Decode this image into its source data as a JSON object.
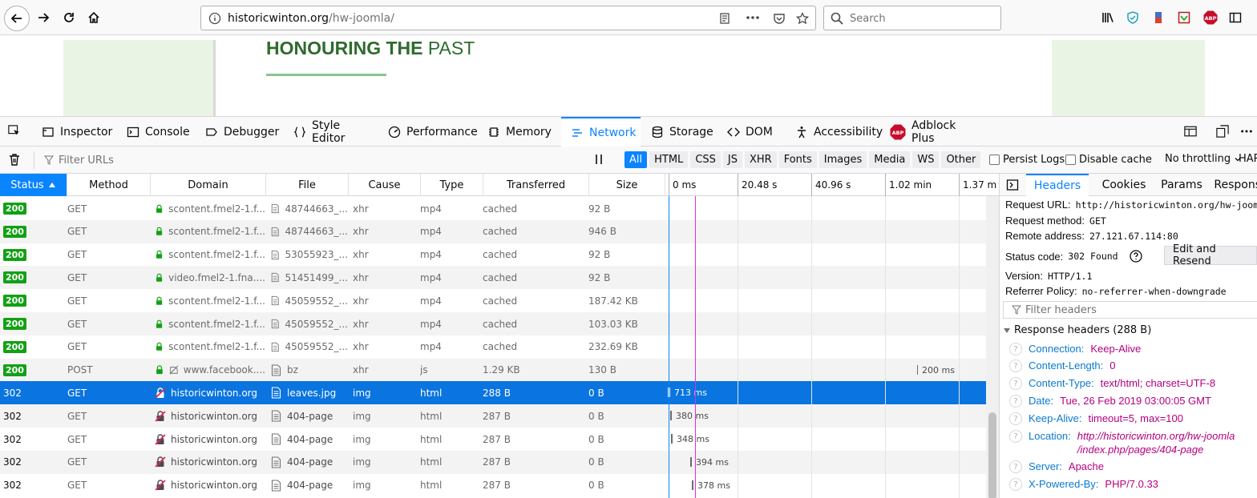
{
  "browser": {
    "url_host": "historicwinton.org",
    "url_path": "/hw-joomla/",
    "search_placeholder": "Search",
    "abp_badge": "ABP"
  },
  "page": {
    "heading_bold": "HONOURING THE",
    "heading_rest": "PAST"
  },
  "devtools": {
    "tabs": [
      {
        "label": "Inspector",
        "icon": "inspector-icon"
      },
      {
        "label": "Console",
        "icon": "console-icon"
      },
      {
        "label": "Debugger",
        "icon": "debugger-icon"
      },
      {
        "label": "Style Editor",
        "icon": "braces-icon"
      },
      {
        "label": "Performance",
        "icon": "gauge-icon"
      },
      {
        "label": "Memory",
        "icon": "memory-chip-icon"
      },
      {
        "label": "Network",
        "icon": "network-icon"
      },
      {
        "label": "Storage",
        "icon": "database-icon"
      },
      {
        "label": "DOM",
        "icon": "angle-brackets-icon"
      },
      {
        "label": "Accessibility",
        "icon": "accessibility-icon"
      },
      {
        "label": "Adblock Plus",
        "icon": "abp-icon"
      }
    ],
    "selected_tab": "Network"
  },
  "network_toolbar": {
    "filter_placeholder": "Filter URLs",
    "type_filters": [
      "All",
      "HTML",
      "CSS",
      "JS",
      "XHR",
      "Fonts",
      "Images",
      "Media",
      "WS",
      "Other"
    ],
    "active_filter": "All",
    "persist_logs": "Persist Logs",
    "disable_cache": "Disable cache",
    "throttling": "No throttling",
    "har": "HAR"
  },
  "table": {
    "columns": [
      "Status",
      "Method",
      "Domain",
      "File",
      "Cause",
      "Type",
      "Transferred",
      "Size"
    ],
    "sorted_column": "Status",
    "waterfall_ticks": [
      "0 ms",
      "20.48 s",
      "40.96 s",
      "1.02 min",
      "1.37 m"
    ],
    "rows": [
      {
        "status": "200",
        "method": "GET",
        "secure": true,
        "domain": "scontent.fmel2-1.f...",
        "file": "48744663_...",
        "cause": "xhr",
        "type": "mp4",
        "transferred": "cached",
        "size": "92 B",
        "timing": ""
      },
      {
        "status": "200",
        "method": "GET",
        "secure": true,
        "domain": "scontent.fmel2-1.f...",
        "file": "48744663_...",
        "cause": "xhr",
        "type": "mp4",
        "transferred": "cached",
        "size": "946 B",
        "timing": ""
      },
      {
        "status": "200",
        "method": "GET",
        "secure": true,
        "domain": "scontent.fmel2-1.f...",
        "file": "53055923_...",
        "cause": "xhr",
        "type": "mp4",
        "transferred": "cached",
        "size": "92 B",
        "timing": ""
      },
      {
        "status": "200",
        "method": "GET",
        "secure": true,
        "domain": "video.fmel2-1.fna....",
        "file": "51451499_...",
        "cause": "xhr",
        "type": "mp4",
        "transferred": "cached",
        "size": "92 B",
        "timing": ""
      },
      {
        "status": "200",
        "method": "GET",
        "secure": true,
        "domain": "scontent.fmel2-1.f...",
        "file": "45059552_...",
        "cause": "xhr",
        "type": "mp4",
        "transferred": "cached",
        "size": "187.42 KB",
        "timing": ""
      },
      {
        "status": "200",
        "method": "GET",
        "secure": true,
        "domain": "scontent.fmel2-1.f...",
        "file": "45059552_...",
        "cause": "xhr",
        "type": "mp4",
        "transferred": "cached",
        "size": "103.03 KB",
        "timing": ""
      },
      {
        "status": "200",
        "method": "GET",
        "secure": true,
        "domain": "scontent.fmel2-1.f...",
        "file": "45059552_...",
        "cause": "xhr",
        "type": "mp4",
        "transferred": "cached",
        "size": "232.69 KB",
        "timing": ""
      },
      {
        "status": "200",
        "method": "POST",
        "secure": true,
        "tracker": true,
        "domain": "www.facebook....",
        "file": "bz",
        "cause": "xhr",
        "type": "js",
        "transferred": "1.29 KB",
        "size": "130 B",
        "timing": "200 ms"
      },
      {
        "status": "302",
        "method": "GET",
        "secure": false,
        "domain": "historicwinton.org",
        "file": "leaves.jpg",
        "cause": "img",
        "type": "html",
        "transferred": "288 B",
        "size": "0 B",
        "timing": "713 ms",
        "selected": true
      },
      {
        "status": "302",
        "method": "GET",
        "secure": false,
        "domain": "historicwinton.org",
        "file": "404-page",
        "cause": "img",
        "type": "html",
        "transferred": "287 B",
        "size": "0 B",
        "timing": "380 ms"
      },
      {
        "status": "302",
        "method": "GET",
        "secure": false,
        "domain": "historicwinton.org",
        "file": "404-page",
        "cause": "img",
        "type": "html",
        "transferred": "287 B",
        "size": "0 B",
        "timing": "348 ms"
      },
      {
        "status": "302",
        "method": "GET",
        "secure": false,
        "domain": "historicwinton.org",
        "file": "404-page",
        "cause": "img",
        "type": "html",
        "transferred": "287 B",
        "size": "0 B",
        "timing": "394 ms"
      },
      {
        "status": "302",
        "method": "GET",
        "secure": false,
        "domain": "historicwinton.org",
        "file": "404-page",
        "cause": "img",
        "type": "html",
        "transferred": "287 B",
        "size": "0 B",
        "timing": "378 ms"
      }
    ]
  },
  "details": {
    "tabs": [
      "Headers",
      "Cookies",
      "Params",
      "Response"
    ],
    "selected_tab": "Headers",
    "summary": [
      {
        "key": "Request URL:",
        "value": "http://historicwinton.org/hw-joomla"
      },
      {
        "key": "Request method:",
        "value": "GET"
      },
      {
        "key": "Remote address:",
        "value": "27.121.67.114:80"
      },
      {
        "key": "Status code:",
        "value": "302 Found"
      },
      {
        "key": "Version:",
        "value": "HTTP/1.1"
      },
      {
        "key": "Referrer Policy:",
        "value": "no-referrer-when-downgrade"
      }
    ],
    "edit_resend": "Edit and Resend",
    "filter_placeholder": "Filter headers",
    "response_headers_title": "Response headers (288 B)",
    "response_headers": [
      {
        "name": "Connection:",
        "value": "Keep-Alive"
      },
      {
        "name": "Content-Length:",
        "value": "0"
      },
      {
        "name": "Content-Type:",
        "value": "text/html; charset=UTF-8"
      },
      {
        "name": "Date:",
        "value": "Tue, 26 Feb 2019 03:00:05 GMT"
      },
      {
        "name": "Keep-Alive:",
        "value": "timeout=5, max=100"
      },
      {
        "name": "Location:",
        "value": "http://historicwinton.org/hw-joomla",
        "value2": "/index.php/pages/404-page",
        "italic": true
      },
      {
        "name": "Server:",
        "value": "Apache"
      },
      {
        "name": "X-Powered-By:",
        "value": "PHP/7.0.33"
      }
    ]
  }
}
